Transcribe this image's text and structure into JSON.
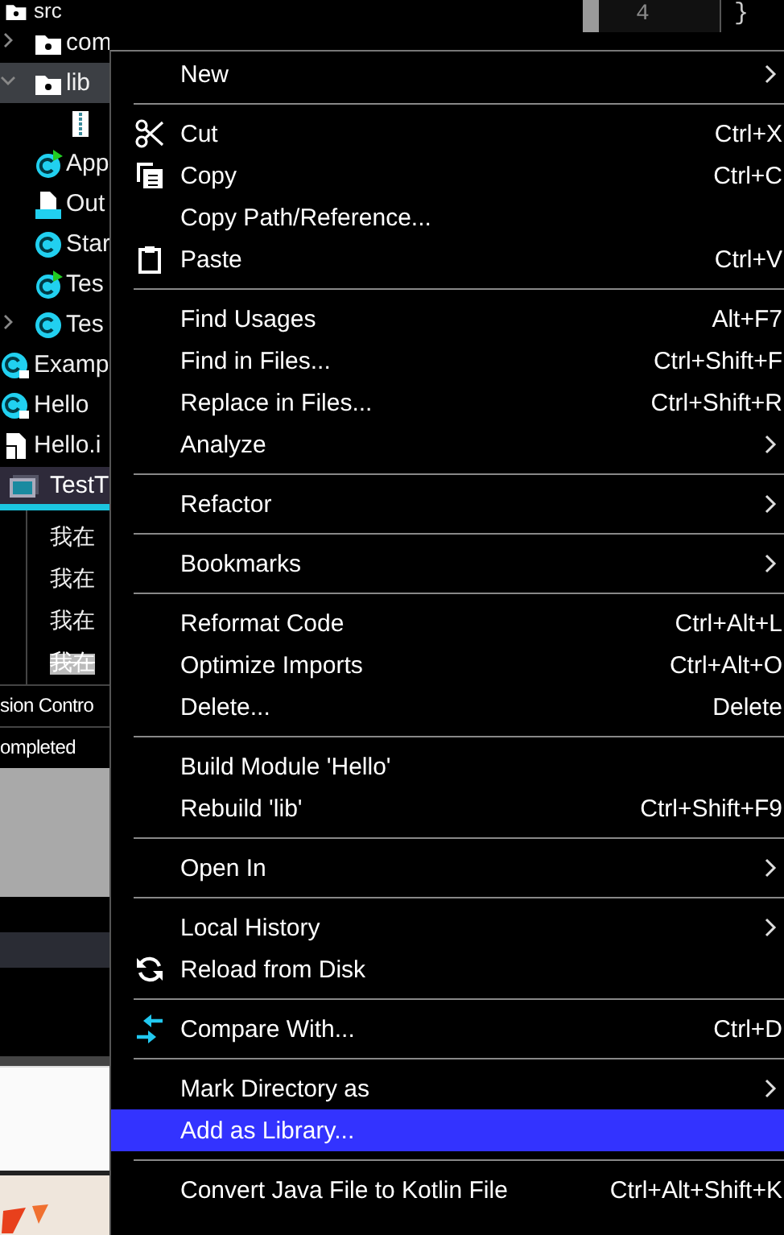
{
  "tree": [
    {
      "label": "src",
      "kind": "folder",
      "selected": false,
      "children": [
        {
          "label": "com",
          "kind": "folder",
          "expanded": false,
          "selected": false
        },
        {
          "label": "lib",
          "kind": "folder",
          "expanded": true,
          "selected": true,
          "children": [
            {
              "kind": "zip",
              "selected": false
            }
          ]
        },
        {
          "label": "App",
          "kind": "class-run",
          "selected": false
        },
        {
          "label": "Out",
          "kind": "output",
          "selected": false
        },
        {
          "label": "Star",
          "kind": "class",
          "selected": false
        },
        {
          "label": "Tes",
          "kind": "class-run",
          "selected": false
        },
        {
          "label": "Tes",
          "kind": "class",
          "expanded": false,
          "selected": false
        }
      ]
    },
    {
      "label": "Examp",
      "kind": "class-locked",
      "selected": false
    },
    {
      "label": "Hello",
      "kind": "class-locked",
      "selected": false
    },
    {
      "label": "Hello.i",
      "kind": "file",
      "selected": false
    }
  ],
  "tool_tab": {
    "label": "TestT",
    "selected": true
  },
  "console_lines": [
    {
      "text": "我在",
      "highlighted": false
    },
    {
      "text": "我在",
      "highlighted": false
    },
    {
      "text": "我在",
      "highlighted": false
    },
    {
      "text": "我在",
      "highlighted": true
    }
  ],
  "status_lines": [
    "sion Contro",
    "ompleted"
  ],
  "editor": {
    "line_number": "4",
    "code": "}"
  },
  "menu": [
    {
      "kind": "item",
      "label": "New",
      "submenu": true,
      "selected": false
    },
    {
      "kind": "separator"
    },
    {
      "kind": "cut",
      "label": "Cut",
      "shortcut": "Ctrl+X",
      "selected": false
    },
    {
      "kind": "copy",
      "label": "Copy",
      "shortcut": "Ctrl+C",
      "selected": false
    },
    {
      "kind": "item",
      "label": "Copy Path/Reference...",
      "selected": false
    },
    {
      "kind": "paste",
      "label": "Paste",
      "shortcut": "Ctrl+V",
      "selected": false
    },
    {
      "kind": "separator"
    },
    {
      "kind": "item",
      "label": "Find Usages",
      "shortcut": "Alt+F7",
      "selected": false
    },
    {
      "kind": "item",
      "label": "Find in Files...",
      "shortcut": "Ctrl+Shift+F",
      "selected": false
    },
    {
      "kind": "item",
      "label": "Replace in Files...",
      "shortcut": "Ctrl+Shift+R",
      "selected": false
    },
    {
      "kind": "item",
      "label": "Analyze",
      "submenu": true,
      "selected": false
    },
    {
      "kind": "separator"
    },
    {
      "kind": "item",
      "label": "Refactor",
      "submenu": true,
      "selected": false
    },
    {
      "kind": "separator"
    },
    {
      "kind": "item",
      "label": "Bookmarks",
      "submenu": true,
      "selected": false
    },
    {
      "kind": "separator"
    },
    {
      "kind": "item",
      "label": "Reformat Code",
      "shortcut": "Ctrl+Alt+L",
      "selected": false
    },
    {
      "kind": "item",
      "label": "Optimize Imports",
      "shortcut": "Ctrl+Alt+O",
      "selected": false
    },
    {
      "kind": "item",
      "label": "Delete...",
      "shortcut": "Delete",
      "selected": false
    },
    {
      "kind": "separator"
    },
    {
      "kind": "item",
      "label": "Build Module 'Hello'",
      "selected": false
    },
    {
      "kind": "item",
      "label": "Rebuild 'lib'",
      "shortcut": "Ctrl+Shift+F9",
      "selected": false
    },
    {
      "kind": "separator"
    },
    {
      "kind": "item",
      "label": "Open In",
      "submenu": true,
      "selected": false
    },
    {
      "kind": "separator"
    },
    {
      "kind": "item",
      "label": "Local History",
      "submenu": true,
      "selected": false
    },
    {
      "kind": "reload",
      "label": "Reload from Disk",
      "selected": false
    },
    {
      "kind": "separator"
    },
    {
      "kind": "compare",
      "label": "Compare With...",
      "shortcut": "Ctrl+D",
      "selected": false
    },
    {
      "kind": "separator"
    },
    {
      "kind": "item",
      "label": "Mark Directory as",
      "submenu": true,
      "selected": false
    },
    {
      "kind": "item",
      "label": "Add as Library...",
      "selected": true
    },
    {
      "kind": "separator"
    },
    {
      "kind": "item",
      "label": "Convert Java File to Kotlin File",
      "shortcut": "Ctrl+Alt+Shift+K",
      "selected": false
    }
  ]
}
